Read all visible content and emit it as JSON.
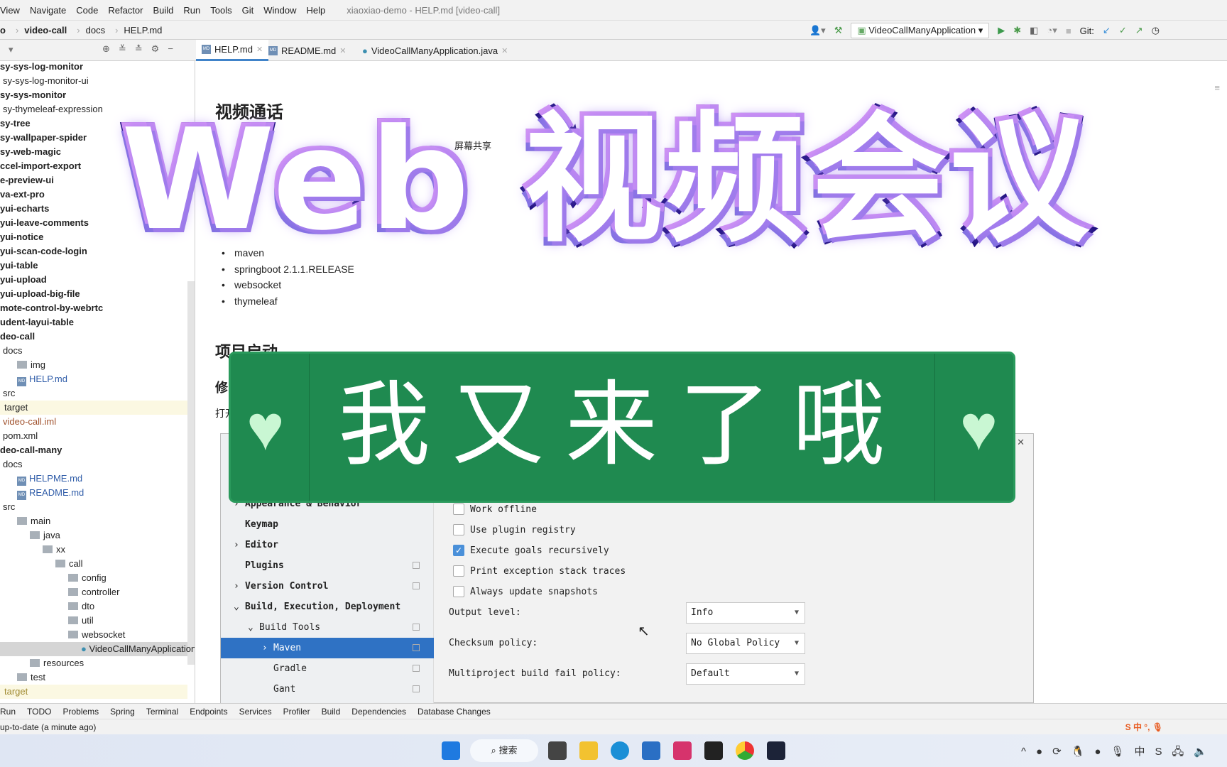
{
  "menu": [
    "View",
    "Navigate",
    "Code",
    "Refactor",
    "Build",
    "Run",
    "Tools",
    "Git",
    "Window",
    "Help"
  ],
  "window_title": "xiaoxiao-demo - HELP.md [video-call]",
  "breadcrumb": [
    "o",
    "video-call",
    "docs",
    "HELP.md"
  ],
  "toolbar": {
    "run_config": "VideoCallManyApplication",
    "git_label": "Git:"
  },
  "tabs": [
    {
      "label": "HELP.md",
      "active": true
    },
    {
      "label": "README.md"
    },
    {
      "label": "VideoCallManyApplication.java"
    }
  ],
  "tree": [
    {
      "label": "sy-sys-log-monitor",
      "bold": true
    },
    {
      "label": "sy-sys-log-monitor-ui"
    },
    {
      "label": "sy-sys-monitor",
      "bold": true
    },
    {
      "label": "sy-thymeleaf-expression"
    },
    {
      "label": "sy-tree",
      "bold": true
    },
    {
      "label": "sy-wallpaper-spider",
      "bold": true
    },
    {
      "label": "sy-web-magic",
      "bold": true
    },
    {
      "label": "ccel-import-export",
      "bold": true
    },
    {
      "label": "e-preview-ui",
      "bold": true
    },
    {
      "label": "va-ext-pro",
      "bold": true
    },
    {
      "label": "yui-echarts",
      "bold": true
    },
    {
      "label": "yui-leave-comments",
      "bold": true
    },
    {
      "label": "yui-notice",
      "bold": true
    },
    {
      "label": "yui-scan-code-login",
      "bold": true
    },
    {
      "label": "yui-table",
      "bold": true
    },
    {
      "label": "yui-upload",
      "bold": true
    },
    {
      "label": "yui-upload-big-file",
      "bold": true
    },
    {
      "label": "mote-control-by-webrtc",
      "bold": true
    },
    {
      "label": "udent-layui-table",
      "bold": true
    },
    {
      "label": "deo-call",
      "bold": true
    },
    {
      "label": "docs",
      "indent": 0
    },
    {
      "label": "img",
      "indent": 1,
      "folder": true
    },
    {
      "label": "HELP.md",
      "indent": 1,
      "md": true
    },
    {
      "label": "src",
      "indent": 0
    },
    {
      "label": "target",
      "indent": 0,
      "hl": true
    },
    {
      "label": "video-call.iml",
      "indent": 0,
      "iml": true
    },
    {
      "label": "pom.xml",
      "indent": 0
    },
    {
      "label": "deo-call-many",
      "bold": true
    },
    {
      "label": "docs",
      "indent": 0
    },
    {
      "label": "HELPME.md",
      "indent": 1,
      "md": true
    },
    {
      "label": "README.md",
      "indent": 1,
      "md": true
    },
    {
      "label": "src",
      "indent": 0
    },
    {
      "label": "main",
      "indent": 1,
      "folder": true
    },
    {
      "label": "java",
      "indent": 2,
      "folder": true
    },
    {
      "label": "xx",
      "indent": 3,
      "folder": true
    },
    {
      "label": "call",
      "indent": 4,
      "folder": true
    },
    {
      "label": "config",
      "indent": 5,
      "folder": true
    },
    {
      "label": "controller",
      "indent": 5,
      "folder": true
    },
    {
      "label": "dto",
      "indent": 5,
      "folder": true
    },
    {
      "label": "util",
      "indent": 5,
      "folder": true
    },
    {
      "label": "websocket",
      "indent": 5,
      "folder": true
    },
    {
      "label": "VideoCallManyApplication",
      "indent": 6,
      "selected": true
    },
    {
      "label": "resources",
      "indent": 2,
      "folder": true
    },
    {
      "label": "test",
      "indent": 1,
      "folder": true
    },
    {
      "label": "target",
      "indent": 0,
      "hl": true
    }
  ],
  "doc": {
    "h1": "视频通话",
    "partial": "屏幕共享",
    "list": [
      "maven",
      "springboot 2.1.1.RELEASE",
      "websocket",
      "thymeleaf"
    ],
    "h2": "项目启动",
    "h3": "修",
    "p": "打开"
  },
  "settings": {
    "nav": [
      {
        "label": "Appearance & Behavior",
        "arrow": "›"
      },
      {
        "label": "Keymap"
      },
      {
        "label": "Editor",
        "arrow": "›"
      },
      {
        "label": "Plugins",
        "pin": true
      },
      {
        "label": "Version Control",
        "arrow": "›",
        "pin": true
      },
      {
        "label": "Build, Execution, Deployment",
        "arrow": "⌄"
      },
      {
        "label": "Build Tools",
        "arrow": "⌄",
        "pin": true,
        "indent": 1
      },
      {
        "label": "Maven",
        "arrow": "›",
        "pin": true,
        "indent": 2,
        "selected": true
      },
      {
        "label": "Gradle",
        "pin": true,
        "indent": 2
      },
      {
        "label": "Gant",
        "pin": true,
        "indent": 2
      }
    ],
    "checks": [
      {
        "label": "Work offline",
        "checked": false
      },
      {
        "label": "Use plugin registry",
        "checked": false
      },
      {
        "label": "Execute goals recursively",
        "checked": true
      },
      {
        "label": "Print exception stack traces",
        "checked": false
      },
      {
        "label": "Always update snapshots",
        "checked": false
      }
    ],
    "fields": [
      {
        "label": "Output level:",
        "value": "Info"
      },
      {
        "label": "Checksum policy:",
        "value": "No Global Policy"
      },
      {
        "label": "Multiproject build fail policy:",
        "value": "Default"
      }
    ]
  },
  "bottom_tools": [
    "Run",
    "TODO",
    "Problems",
    "Spring",
    "Terminal",
    "Endpoints",
    "Services",
    "Profiler",
    "Build",
    "Dependencies",
    "Database Changes"
  ],
  "status": "up-to-date (a minute ago)",
  "taskbar": {
    "search": "搜索"
  },
  "overlay": {
    "title": "Web 视频会议",
    "subtitle": "我又来了哦",
    "title_fill": "#ffffff",
    "title_stroke": "#1a0c7c",
    "glow": "#b48af0",
    "banner_color": "#1f8a50",
    "heart_color": "#c9f7d3"
  }
}
